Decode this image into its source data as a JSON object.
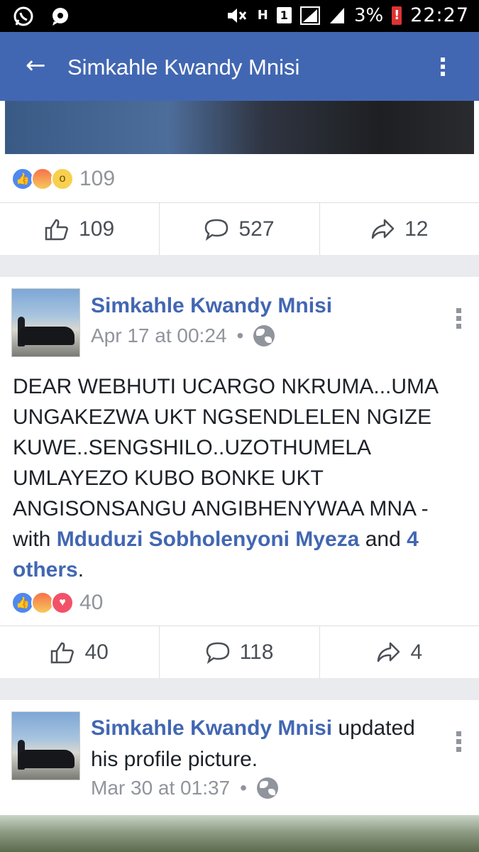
{
  "status_bar": {
    "network": "H",
    "sim": "1",
    "battery": "3%",
    "battery_alert": "!",
    "time": "22:27",
    "icons": [
      "whatsapp-icon",
      "chat-icon",
      "mute-icon",
      "signal-icon",
      "signal-icon-2",
      "battery-icon"
    ]
  },
  "header": {
    "back_icon": "arrow-left-icon",
    "title": "Simkahle Kwandy Mnisi",
    "menu_icon": "kebab-menu-icon"
  },
  "post1": {
    "reaction_count": "109",
    "reactions": [
      "like",
      "angry",
      "wow"
    ],
    "actions": {
      "like_count": "109",
      "comment_count": "527",
      "share_count": "12"
    }
  },
  "post2": {
    "author": "Simkahle Kwandy Mnisi",
    "time": "Apr 17 at 00:24",
    "separator": "•",
    "text_line1": "DEAR WEBHUTI UCARGO NKRUMA...UMA UNGAKEZWA UKT NGSENDLELEN NGIZE KUWE..SENGSHILO..UZOTHUMELA UMLAYEZO KUBO BONKE UKT ANGISONSANGU ANGIBHENYWAA MNA - with ",
    "tagged": "Mduduzi Sobholenyoni Myeza",
    "and": " and ",
    "others": "4 others",
    "end": ".",
    "reaction_count": "40",
    "reactions": [
      "like",
      "angry",
      "love"
    ],
    "actions": {
      "like_count": "40",
      "comment_count": "118",
      "share_count": "4"
    }
  },
  "post3": {
    "author": "Simkahle Kwandy Mnisi",
    "action_text": " updated his profile picture.",
    "time": "Mar 30 at 01:37",
    "separator": "•"
  },
  "colors": {
    "brand": "#4267b2",
    "meta_gray": "#90949c",
    "text": "#1d2129"
  }
}
